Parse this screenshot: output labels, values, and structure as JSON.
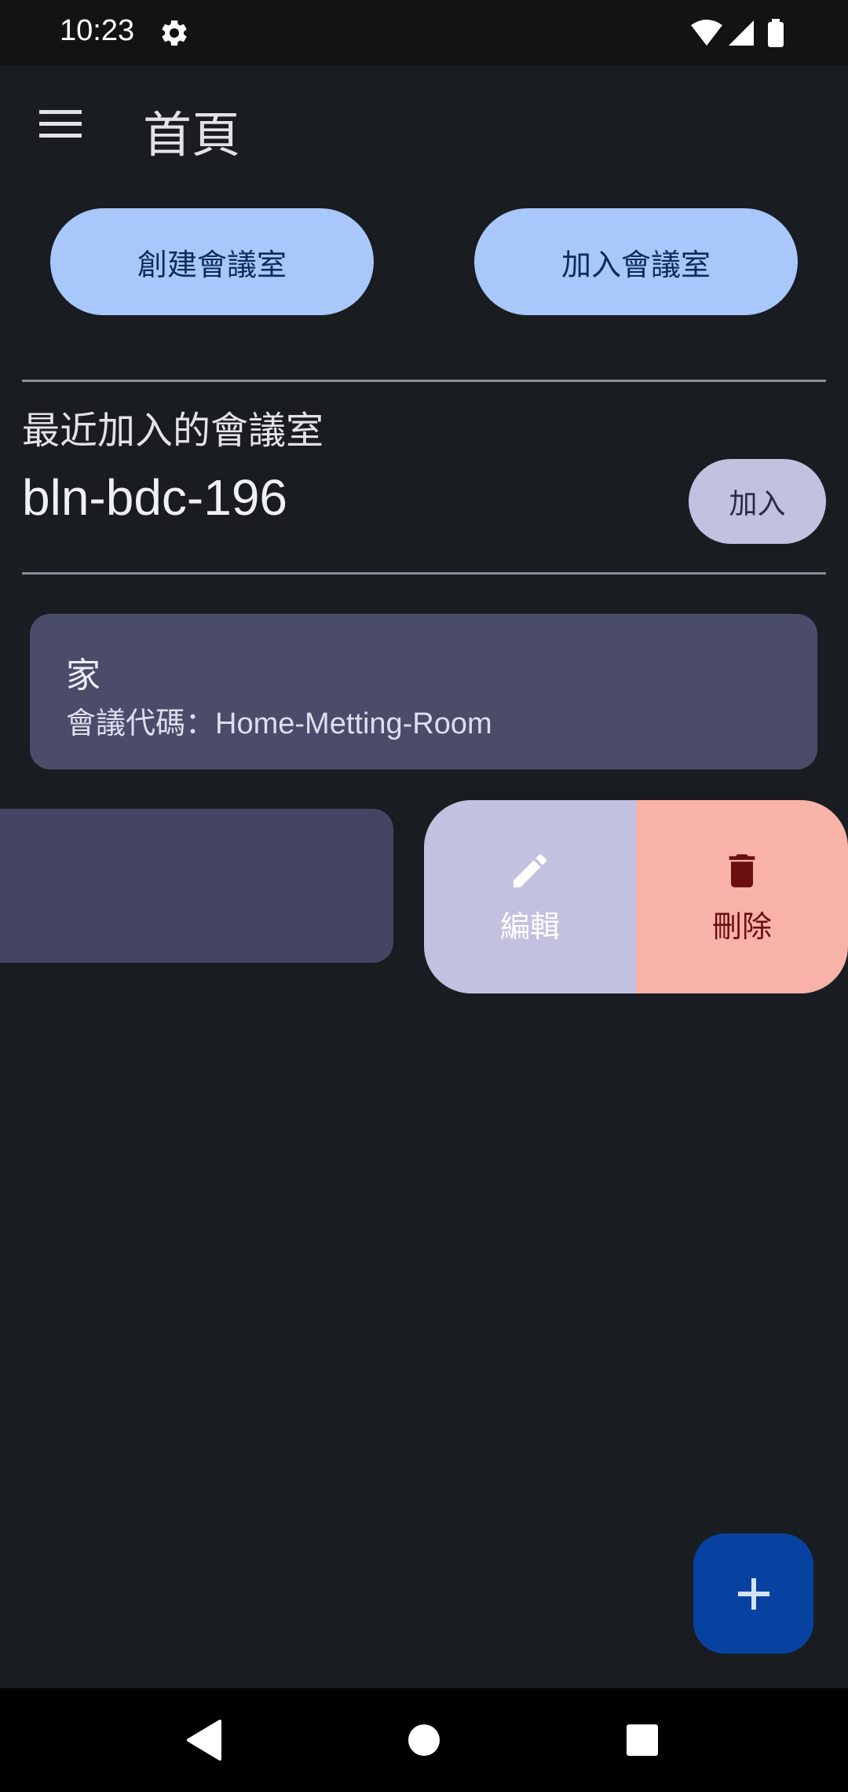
{
  "status_bar": {
    "time": "10:23",
    "icons": [
      "settings-icon",
      "wifi-icon",
      "signal-icon",
      "battery-icon"
    ]
  },
  "app_bar": {
    "title": "首頁",
    "menu_icon": "menu-icon"
  },
  "actions": {
    "create_room_label": "創建會議室",
    "join_room_label": "加入會議室"
  },
  "recent": {
    "section_title": "最近加入的會議室",
    "room_code": "bln-bdc-196",
    "join_label": "加入"
  },
  "rooms": [
    {
      "name": "家",
      "code_label": "會議代碼：",
      "code": "Home-Metting-Room"
    }
  ],
  "swipe_actions": {
    "edit_label": "編輯",
    "delete_label": "刪除",
    "edit_icon": "pencil-icon",
    "delete_icon": "trash-icon"
  },
  "fab": {
    "icon": "plus-icon"
  },
  "nav_bar": {
    "icons": [
      "back-icon",
      "home-icon",
      "recents-icon"
    ]
  },
  "colors": {
    "background": "#191c20",
    "primary_button": "#a8c7fa",
    "card": "#4a4c69",
    "edit_action": "#c2c1e0",
    "delete_action": "#f8b2a8",
    "fab": "#0842a0"
  }
}
